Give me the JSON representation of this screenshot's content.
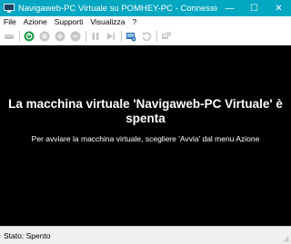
{
  "window": {
    "title": "Navigaweb-PC Virtuale su POMHEY-PC - Connessione macchin...",
    "accent": "#03a7c2",
    "buttons": {
      "minimize": "—",
      "maximize": "☐",
      "close": "✕"
    }
  },
  "menu": {
    "items": [
      "File",
      "Azione",
      "Supporti",
      "Visualizza",
      "?"
    ]
  },
  "toolbar": {
    "buttons": [
      {
        "name": "ctrl-alt-del-icon",
        "enabled": false
      },
      {
        "name": "start-icon",
        "enabled": true
      },
      {
        "name": "turn-off-icon",
        "enabled": false
      },
      {
        "name": "shutdown-icon",
        "enabled": false
      },
      {
        "name": "save-icon",
        "enabled": false
      },
      {
        "name": "pause-icon",
        "enabled": false
      },
      {
        "name": "reset-icon",
        "enabled": false
      },
      {
        "name": "checkpoint-icon",
        "enabled": true
      },
      {
        "name": "revert-icon",
        "enabled": false
      },
      {
        "name": "enhanced-session-icon",
        "enabled": false
      }
    ]
  },
  "screen": {
    "message_title": "La macchina virtuale 'Navigaweb-PC Virtuale' è spenta",
    "message_subtitle": "Per avviare la macchina virtuale, scegliere 'Avvia' dal menu Azione"
  },
  "status": {
    "text": "Stato: Spento"
  }
}
